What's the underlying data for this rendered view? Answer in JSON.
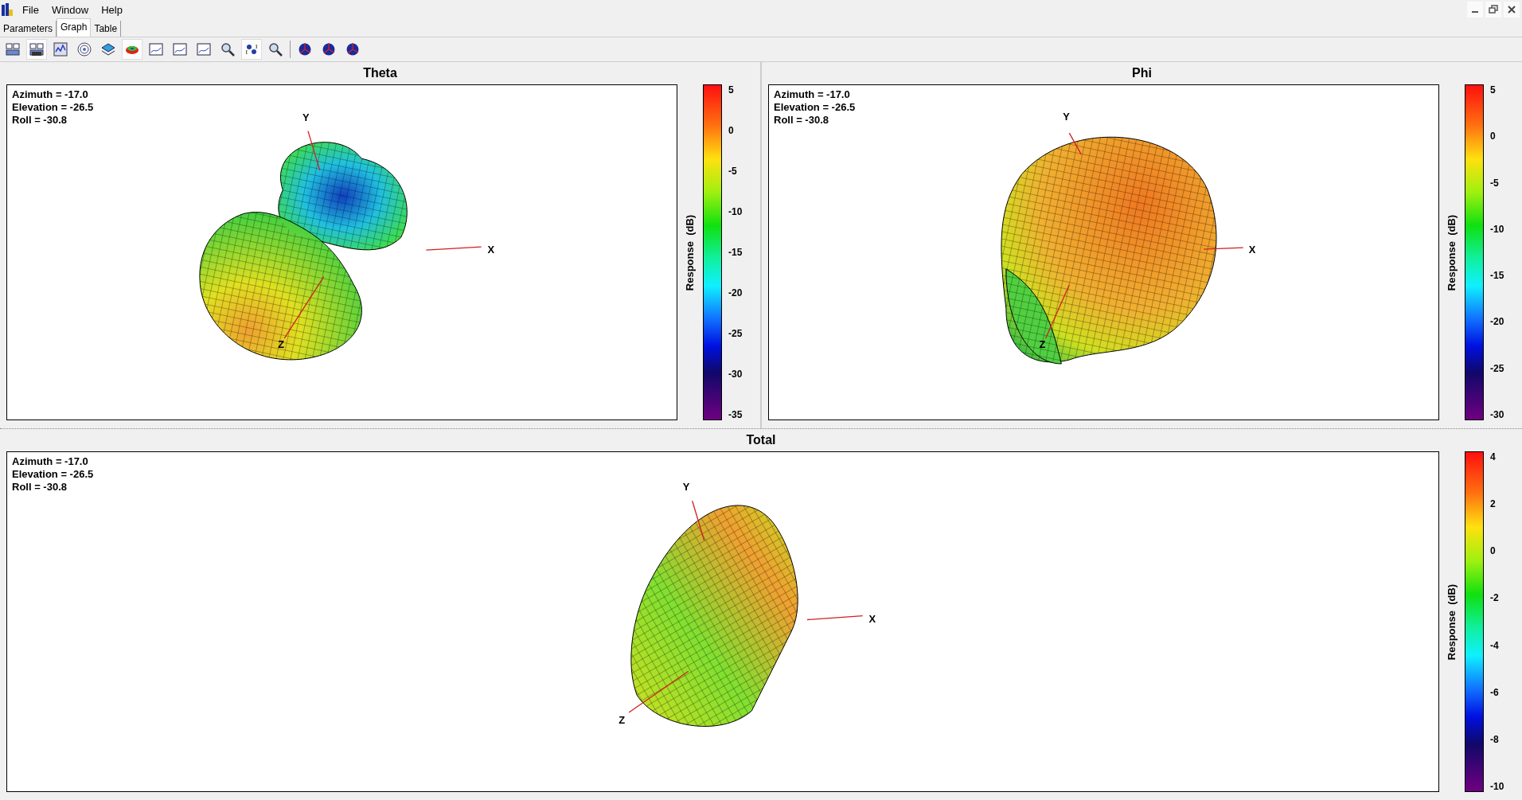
{
  "menu": [
    {
      "label": "File"
    },
    {
      "label": "Window"
    },
    {
      "label": "Help"
    }
  ],
  "tabs": [
    {
      "label": "Parameters",
      "selected": false
    },
    {
      "label": "Graph",
      "selected": true
    },
    {
      "label": "Table",
      "selected": false
    }
  ],
  "toolbar": [
    {
      "kind": "windows",
      "pressed": false
    },
    {
      "kind": "windows-stack",
      "pressed": true
    },
    {
      "kind": "chart",
      "pressed": false
    },
    {
      "kind": "target",
      "pressed": false
    },
    {
      "kind": "layers",
      "pressed": false
    },
    {
      "kind": "donut",
      "pressed": true
    },
    {
      "kind": "plot",
      "pressed": false
    },
    {
      "kind": "plot",
      "pressed": false
    },
    {
      "kind": "plot",
      "pressed": false
    },
    {
      "kind": "magnifier",
      "pressed": false
    },
    {
      "kind": "rotate",
      "pressed": true
    },
    {
      "kind": "magnifier",
      "pressed": false
    },
    {
      "kind": "sphere",
      "pressed": false
    },
    {
      "kind": "sphere",
      "pressed": false
    },
    {
      "kind": "sphere",
      "pressed": false
    }
  ],
  "plots": [
    {
      "kind": "theta",
      "title": "Theta",
      "info": [
        "Azimuth = -17.0",
        "Elevation = -26.5",
        "Roll = -30.8"
      ],
      "axes": {
        "x": "X",
        "y": "Y",
        "z": "Z"
      },
      "colorbar": {
        "title": "Response  (dB)",
        "ticks": [
          "5",
          "0",
          "-5",
          "-10",
          "-15",
          "-20",
          "-25",
          "-30",
          "-35"
        ]
      }
    },
    {
      "kind": "phi",
      "title": "Phi",
      "info": [
        "Azimuth = -17.0",
        "Elevation = -26.5",
        "Roll = -30.8"
      ],
      "axes": {
        "x": "X",
        "y": "Y",
        "z": "Z"
      },
      "colorbar": {
        "title": "Response  (dB)",
        "ticks": [
          "5",
          "0",
          "-5",
          "-10",
          "-15",
          "-20",
          "-25",
          "-30"
        ]
      }
    },
    {
      "kind": "total",
      "title": "Total",
      "info": [
        "Azimuth = -17.0",
        "Elevation = -26.5",
        "Roll = -30.8"
      ],
      "axes": {
        "x": "X",
        "y": "Y",
        "z": "Z"
      },
      "colorbar": {
        "title": "Response  (dB)",
        "ticks": [
          "4",
          "2",
          "0",
          "-2",
          "-4",
          "-6",
          "-8",
          "-10"
        ]
      }
    }
  ]
}
